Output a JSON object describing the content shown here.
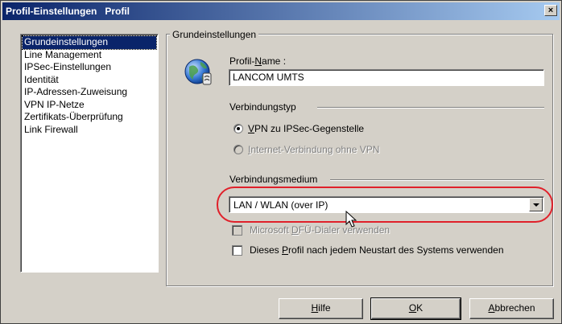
{
  "window": {
    "title": "Profil-Einstellungen   Profil",
    "close_glyph": "×"
  },
  "nav": {
    "items": [
      {
        "label": "Grundeinstellungen",
        "selected": true
      },
      {
        "label": "Line Management"
      },
      {
        "label": "IPSec-Einstellungen"
      },
      {
        "label": "Identität"
      },
      {
        "label": "IP-Adressen-Zuweisung"
      },
      {
        "label": "VPN IP-Netze"
      },
      {
        "label": "Zertifikats-Überprüfung"
      },
      {
        "label": "Link Firewall"
      }
    ]
  },
  "group": {
    "title": "Grundeinstellungen",
    "profile_icon": "globe-connection-icon",
    "profile_name_label_pre": "Profil-",
    "profile_name_label_accel": "N",
    "profile_name_label_post": "ame :",
    "profile_name_value": "LANCOM UMTS",
    "connection_type_label": "Verbindungstyp",
    "radio_vpn_accel": "V",
    "radio_vpn_rest": "PN zu IPSec-Gegenstelle",
    "radio_vpn_checked": true,
    "radio_internet_pre": "I",
    "radio_internet_rest": "nternet-Verbindung ohne VPN",
    "radio_internet_disabled": true,
    "medium_label": "Verbindungsmedium",
    "medium_value": "LAN / WLAN (over IP)",
    "dialer_checkbox_pre": "Microsoft ",
    "dialer_checkbox_accel": "D",
    "dialer_checkbox_post": "FÜ-Dialer verwenden",
    "dialer_checked": false,
    "dialer_disabled": true,
    "restart_checkbox_pre": "Dieses ",
    "restart_checkbox_accel": "P",
    "restart_checkbox_post": "rofil nach jedem Neustart des Systems verwenden",
    "restart_checked": false
  },
  "buttons": {
    "help_accel": "H",
    "help_rest": "ilfe",
    "ok_accel": "O",
    "ok_rest": "K",
    "cancel_accel": "A",
    "cancel_rest": "bbrechen"
  },
  "colors": {
    "title_bar": "#0a246a",
    "selection": "#0a246a",
    "highlight": "#e0202a",
    "window": "#d4d0c8"
  }
}
